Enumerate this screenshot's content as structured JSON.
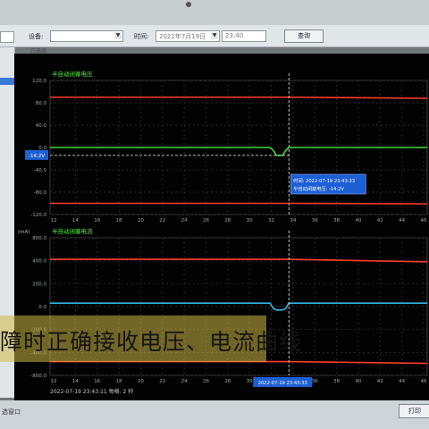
{
  "toolbar": {
    "device_label": "设备:",
    "time_label": "时间:",
    "date_value": "2022年7月19日",
    "time_value": "23:40",
    "query_button": "查询",
    "tab_label": "已选择"
  },
  "charts": [
    {
      "title": "半自动闭塞电压",
      "title_color": "#4ef03c",
      "ylim": [
        -120,
        120
      ],
      "yticks": [
        "120.0",
        "80.0",
        "40.0",
        "0.0",
        "-40.0",
        "-80.0",
        "-120.0"
      ],
      "xticks": [
        "12",
        "14",
        "16",
        "18",
        "20",
        "22",
        "24",
        "26",
        "28",
        "30",
        "32",
        "34",
        "36",
        "38",
        "40",
        "42",
        "44",
        "46"
      ],
      "cursor_value": "-14.2V",
      "tooltip": {
        "line1": "时间: 2022-07-19 23:43:33",
        "line2": "半自动闭塞电压:    -14.2V"
      }
    },
    {
      "title": "半自动闭塞电流",
      "title_color": "#4ef03c",
      "unit": "(mA)",
      "ylim": [
        -800,
        800
      ],
      "yticks": [
        "800.0",
        "400.0",
        "200.0",
        "0.0",
        "-200.0",
        "-400.0",
        "-800.0"
      ],
      "xticks": [
        "12",
        "14",
        "16",
        "18",
        "20",
        "22",
        "24",
        "26",
        "28",
        "30",
        "32",
        "34",
        "36",
        "38",
        "40",
        "42",
        "44",
        "46"
      ],
      "time_readout": "2022-07-19 23:43:33",
      "footer": "2022-07-19  23:43:11   每格: 2 秒"
    }
  ],
  "chart_data": [
    {
      "type": "line",
      "title": "半自动闭塞电压",
      "ylim": [
        -120,
        120
      ],
      "x": [
        11,
        32,
        32.3,
        32.6,
        33.2,
        33.5,
        33.8,
        47
      ],
      "series": [
        {
          "color": "#3dd83a",
          "values": [
            0,
            0,
            -5,
            -14.2,
            -14.2,
            -5,
            0,
            0
          ]
        },
        {
          "color": "#ff3b2a",
          "values": [
            90,
            90,
            90,
            90,
            90,
            90,
            90,
            88
          ]
        },
        {
          "color": "#ff3b2a",
          "values": [
            -100,
            -100,
            -100,
            -100,
            -100,
            -100,
            -100,
            -101
          ]
        }
      ]
    },
    {
      "type": "line",
      "title": "半自动闭塞电流",
      "ylim": [
        -800,
        800
      ],
      "x": [
        11,
        32,
        32.3,
        32.6,
        33.2,
        33.5,
        33.8,
        47
      ],
      "series": [
        {
          "color": "#2fb7e8",
          "values": [
            40,
            40,
            -20,
            -40,
            -40,
            -20,
            40,
            40
          ]
        },
        {
          "color": "#ff3b2a",
          "values": [
            550,
            550,
            550,
            550,
            550,
            550,
            550,
            520
          ]
        },
        {
          "color": "#ff3b2a",
          "values": [
            -640,
            -640,
            -640,
            -640,
            -640,
            -640,
            -640,
            -660
          ]
        }
      ]
    }
  ],
  "subtitle": "障时正确接收电压、电流曲线",
  "status": {
    "left": "选窗口",
    "right_button": "打印"
  }
}
